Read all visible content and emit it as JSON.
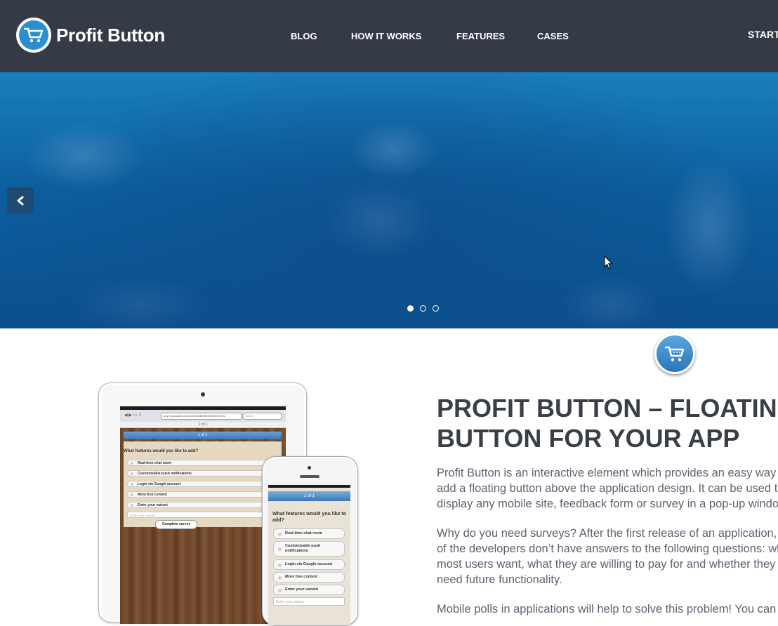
{
  "header": {
    "logo_text": "Profit Button",
    "nav": [
      "BLOG",
      "HOW IT WORKS",
      "FEATURES",
      "CASES"
    ],
    "cta": "START",
    "background": "#343a46"
  },
  "slider": {
    "prev_icon": "chevron-left-icon",
    "dots": 3,
    "active_dot": 1
  },
  "floating_button": {
    "icon": "cart-icon",
    "color": "#2a76b8"
  },
  "content": {
    "headline_line1": "PROFIT BUTTON – FLOATING",
    "headline_line2": "BUTTON FOR YOUR APP",
    "p1_line1": "Profit Button is an interactive element which provides an easy way to",
    "p1_line2": "add a floating button above the application design. It can be used to",
    "p1_line3": "display any mobile site, feedback form or survey in a pop-up window.",
    "p2_line1": "Why do you need surveys? After the first release of an application, most",
    "p2_line2": "of the developers don’t have answers to the following questions: what",
    "p2_line3": "most users want, what they are willing to pay for and whether they",
    "p2_line4": "need future functionality.",
    "p3_line1": "Mobile polls in applications will help to solve this problem! You can"
  },
  "ipad_mock": {
    "url": "survey.pozadim.com/f224984345f0c02000000001",
    "search_placeholder": "Search",
    "page": "1 of 1",
    "progress": "1 of 1",
    "question": "What features would you like to add?",
    "options": [
      "Real-time chat room",
      "Customizable push notifications",
      "Login via Google account",
      "More free content",
      "Enter your variant"
    ],
    "input_placeholder": "Enter your variant...",
    "submit": "Complete survey"
  },
  "iphone_mock": {
    "progress": "1 of 1",
    "question": "What features would you like to add?",
    "options": [
      "Real-time chat room",
      "Customizable push notifications",
      "Login via Google account",
      "More free content",
      "Enter your variant"
    ],
    "input_placeholder": "Enter your variant"
  }
}
